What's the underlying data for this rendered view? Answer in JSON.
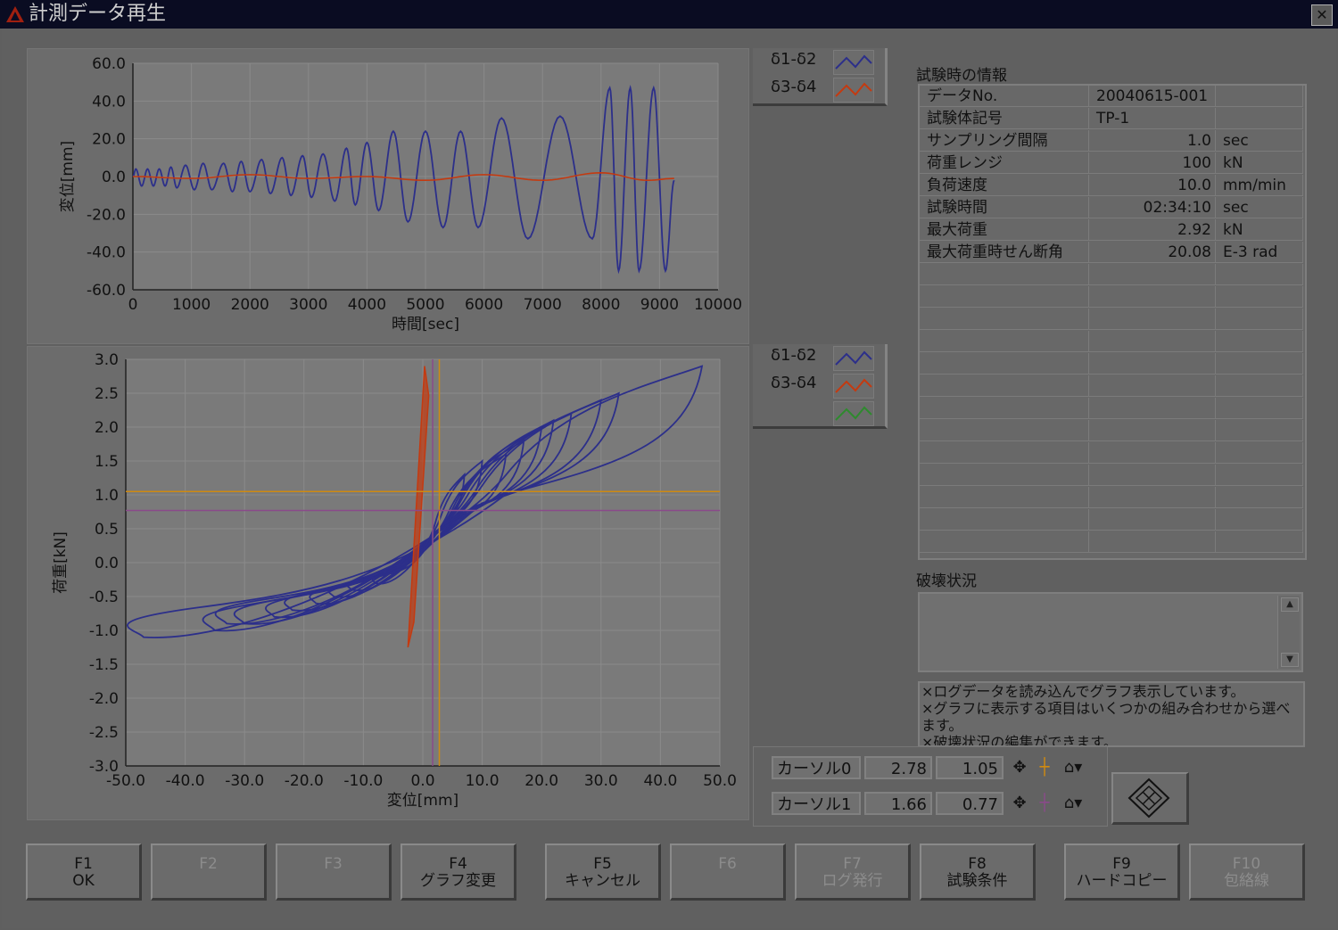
{
  "window": {
    "title": "計測データ再生"
  },
  "colors": {
    "blue": "#2c2f8a",
    "red": "#c43a10",
    "green": "#2e8a2e",
    "orange": "#d08a10",
    "purple": "#8a4a8a",
    "plot_bg": "#7a7a7a",
    "grid": "#8a8a8a"
  },
  "legend_top": {
    "items": [
      {
        "label": "δ1-δ2"
      },
      {
        "label": "δ3-δ4"
      }
    ]
  },
  "legend_bottom": {
    "items": [
      {
        "label": "δ1-δ2"
      },
      {
        "label": "δ3-δ4"
      },
      {
        "label": ""
      }
    ]
  },
  "chart_data": [
    {
      "type": "line",
      "xlabel": "時間[sec]",
      "ylabel": "変位[mm]",
      "xlim": [
        0,
        10000
      ],
      "ylim": [
        -60,
        60
      ],
      "xticks": [
        "0",
        "1000",
        "2000",
        "3000",
        "4000",
        "5000",
        "6000",
        "7000",
        "8000",
        "9000",
        "10000"
      ],
      "yticks": [
        "60.0",
        "40.0",
        "20.0",
        "0.0",
        "-20.0",
        "-40.0",
        "-60.0"
      ],
      "series": [
        {
          "name": "δ1-δ2",
          "color": "blue",
          "peaks": [
            [
              50,
              4
            ],
            [
              150,
              -5
            ],
            [
              250,
              4
            ],
            [
              350,
              -5
            ],
            [
              450,
              4
            ],
            [
              550,
              -5
            ],
            [
              650,
              5
            ],
            [
              750,
              -6
            ],
            [
              900,
              6
            ],
            [
              1050,
              -7
            ],
            [
              1200,
              7
            ],
            [
              1350,
              -7
            ],
            [
              1550,
              7
            ],
            [
              1700,
              -8
            ],
            [
              1850,
              8
            ],
            [
              2000,
              -8
            ],
            [
              2200,
              9
            ],
            [
              2350,
              -9
            ],
            [
              2550,
              10
            ],
            [
              2700,
              -10
            ],
            [
              2900,
              11
            ],
            [
              3050,
              -11
            ],
            [
              3250,
              12
            ],
            [
              3450,
              -13
            ],
            [
              3650,
              15
            ],
            [
              3800,
              -15
            ],
            [
              4000,
              18
            ],
            [
              4200,
              -18
            ],
            [
              4450,
              24
            ],
            [
              4700,
              -24
            ],
            [
              5000,
              24
            ],
            [
              5300,
              -27
            ],
            [
              5600,
              24
            ],
            [
              5900,
              -27
            ],
            [
              6300,
              31
            ],
            [
              6750,
              -33
            ],
            [
              7300,
              32
            ],
            [
              7850,
              -33
            ],
            [
              8150,
              47
            ],
            [
              8300,
              -50
            ],
            [
              8500,
              47
            ],
            [
              8650,
              -50
            ],
            [
              8900,
              47
            ],
            [
              9100,
              -50
            ],
            [
              9250,
              -2
            ]
          ]
        },
        {
          "name": "δ3-δ4",
          "color": "red",
          "peaks": [
            [
              0,
              0
            ],
            [
              1000,
              -1
            ],
            [
              2000,
              1
            ],
            [
              3000,
              -1
            ],
            [
              4000,
              0
            ],
            [
              5000,
              -2
            ],
            [
              6000,
              1
            ],
            [
              7000,
              -2
            ],
            [
              8000,
              2
            ],
            [
              8800,
              -2
            ],
            [
              9250,
              -1
            ]
          ]
        }
      ]
    },
    {
      "type": "scatter",
      "xlabel": "変位[mm]",
      "ylabel": "荷重[kN]",
      "xlim": [
        -50,
        50
      ],
      "ylim": [
        -3,
        3
      ],
      "xticks": [
        "-50.0",
        "-40.0",
        "-30.0",
        "-20.0",
        "-10.0",
        "0.0",
        "10.0",
        "20.0",
        "30.0",
        "40.0",
        "50.0"
      ],
      "yticks": [
        "3.0",
        "2.5",
        "2.0",
        "1.5",
        "1.0",
        "0.5",
        "0.0",
        "-0.5",
        "-1.0",
        "-1.5",
        "-2.0",
        "-2.5",
        "-3.0"
      ],
      "loops": [
        [
          -47,
          -1.1,
          47,
          2.9
        ],
        [
          -35,
          -1.0,
          33,
          2.5
        ],
        [
          -33,
          -0.9,
          30,
          2.4
        ],
        [
          -30,
          -0.9,
          25,
          2.2
        ],
        [
          -25,
          -0.8,
          22,
          2.1
        ],
        [
          -22,
          -0.7,
          20,
          2.0
        ],
        [
          -18,
          -0.6,
          17,
          1.8
        ],
        [
          -15,
          -0.5,
          14,
          1.6
        ],
        [
          -12,
          -0.4,
          10,
          1.5
        ],
        [
          -8,
          -0.3,
          7,
          1.3
        ]
      ],
      "red_branch": {
        "xmin": -2.5,
        "xmax": 1.0,
        "ymin": -1.25,
        "ymax": 2.9
      },
      "cursors": [
        {
          "x": 2.78,
          "y": 1.05,
          "color": "orange"
        },
        {
          "x": 1.66,
          "y": 0.77,
          "color": "purple"
        }
      ]
    }
  ],
  "info": {
    "heading": "試験時の情報",
    "rows": [
      {
        "label": "データNo.",
        "value": "20040615-001",
        "unit": ""
      },
      {
        "label": "試験体記号",
        "value": "TP-1",
        "unit": ""
      },
      {
        "label": "サンプリング間隔",
        "value": "1.0",
        "unit": "sec"
      },
      {
        "label": "荷重レンジ",
        "value": "100",
        "unit": "kN"
      },
      {
        "label": "負荷速度",
        "value": "10.0",
        "unit": "mm/min"
      },
      {
        "label": "試験時間",
        "value": "02:34:10",
        "unit": "sec"
      },
      {
        "label": "最大荷重",
        "value": "2.92",
        "unit": "kN"
      },
      {
        "label": "最大荷重時せん断角",
        "value": "20.08",
        "unit": "E-3 rad"
      }
    ]
  },
  "hakai": {
    "heading": "破壊状況",
    "text": ""
  },
  "messages": [
    "×ログデータを読み込んでグラフ表示しています。",
    "×グラフに表示する項目はいくつかの組み合わせから選べます。",
    "×破壊状況の編集ができます。"
  ],
  "cursors": [
    {
      "name": "カーソル0",
      "x": "2.78",
      "y": "1.05"
    },
    {
      "name": "カーソル1",
      "x": "1.66",
      "y": "0.77"
    }
  ],
  "fkeys": [
    {
      "key": "F1",
      "label": "OK",
      "enabled": true
    },
    {
      "key": "F2",
      "label": "",
      "enabled": false
    },
    {
      "key": "F3",
      "label": "",
      "enabled": false
    },
    {
      "key": "F4",
      "label": "グラフ変更",
      "enabled": true
    },
    {
      "key": "F5",
      "label": "キャンセル",
      "enabled": true
    },
    {
      "key": "F6",
      "label": "",
      "enabled": false
    },
    {
      "key": "F7",
      "label": "ログ発行",
      "enabled": false
    },
    {
      "key": "F8",
      "label": "試験条件",
      "enabled": true
    },
    {
      "key": "F9",
      "label": "ハードコピー",
      "enabled": true
    },
    {
      "key": "F10",
      "label": "包絡線",
      "enabled": false
    }
  ]
}
